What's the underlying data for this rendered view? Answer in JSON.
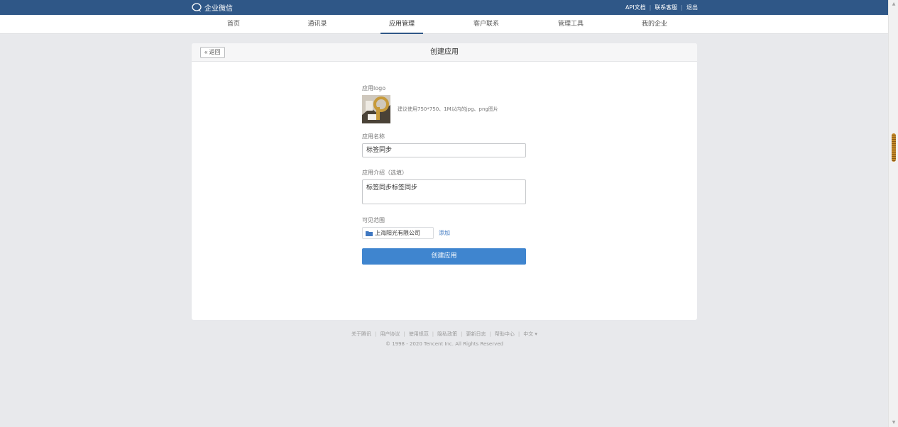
{
  "brand": {
    "name": "企业微信"
  },
  "top_links": [
    "API文档",
    "联系客服",
    "退出"
  ],
  "nav": {
    "items": [
      {
        "label": "首页"
      },
      {
        "label": "通讯录"
      },
      {
        "label": "应用管理",
        "active": true
      },
      {
        "label": "客户联系"
      },
      {
        "label": "管理工具"
      },
      {
        "label": "我的企业"
      }
    ]
  },
  "panel": {
    "back_label": "« 返回",
    "title": "创建应用"
  },
  "form": {
    "logo_label": "应用logo",
    "logo_hint": "建议使用750*750、1M以内的jpg、png图片",
    "name_label": "应用名称",
    "name_value": "标签同步",
    "intro_label": "应用介绍（选填）",
    "intro_value": "标签同步标签同步",
    "scope_label": "可见范围",
    "scope_value": "上海阳光有限公司",
    "add_label": "添加",
    "submit_label": "创建应用"
  },
  "footer": {
    "links": [
      "关于腾讯",
      "用户协议",
      "使用规范",
      "隐私政策",
      "更新日志",
      "帮助中心",
      "中文 ▾"
    ],
    "copyright": "© 1998 - 2020 Tencent Inc. All Rights Reserved"
  },
  "colors": {
    "topbar": "#2f5787",
    "primary_button": "#3f85cf",
    "link": "#3f78c1",
    "background": "#e8e9ec"
  }
}
